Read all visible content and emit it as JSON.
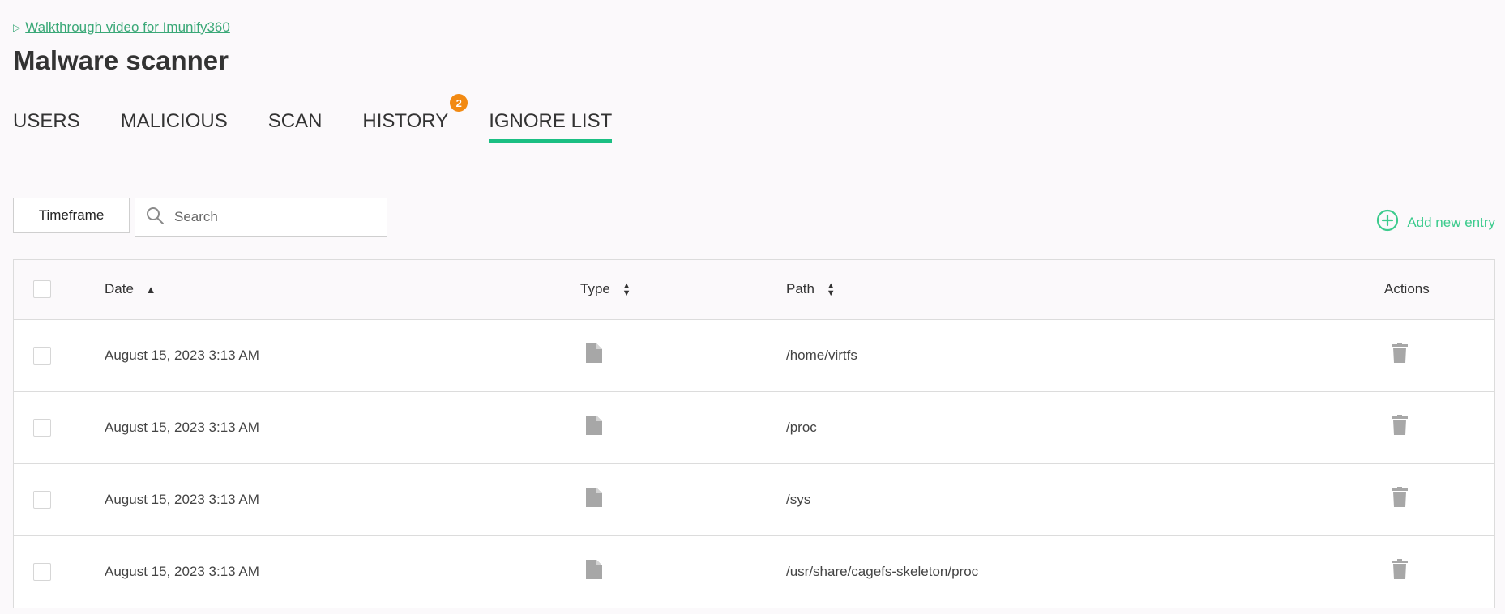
{
  "walkthrough": {
    "link_text": "Walkthrough video for Imunify360"
  },
  "page": {
    "title": "Malware scanner"
  },
  "tabs": [
    {
      "label": "USERS",
      "active": false
    },
    {
      "label": "MALICIOUS",
      "active": false
    },
    {
      "label": "SCAN",
      "active": false
    },
    {
      "label": "HISTORY",
      "active": false,
      "badge": "2"
    },
    {
      "label": "IGNORE LIST",
      "active": true
    }
  ],
  "toolbar": {
    "timeframe_label": "Timeframe",
    "search_placeholder": "Search",
    "add_entry_label": "Add new entry"
  },
  "table": {
    "columns": {
      "date": "Date",
      "type": "Type",
      "path": "Path",
      "actions": "Actions"
    },
    "rows": [
      {
        "date": "August 15, 2023 3:13 AM",
        "type_icon": "file-icon",
        "path": "/home/virtfs"
      },
      {
        "date": "August 15, 2023 3:13 AM",
        "type_icon": "file-icon",
        "path": "/proc"
      },
      {
        "date": "August 15, 2023 3:13 AM",
        "type_icon": "file-icon",
        "path": "/sys"
      },
      {
        "date": "August 15, 2023 3:13 AM",
        "type_icon": "file-icon",
        "path": "/usr/share/cagefs-skeleton/proc"
      }
    ]
  },
  "colors": {
    "accent_green": "#1bbf83",
    "link_green": "#3aa877",
    "badge_orange": "#f28a12",
    "icon_gray": "#a7a7a7"
  }
}
